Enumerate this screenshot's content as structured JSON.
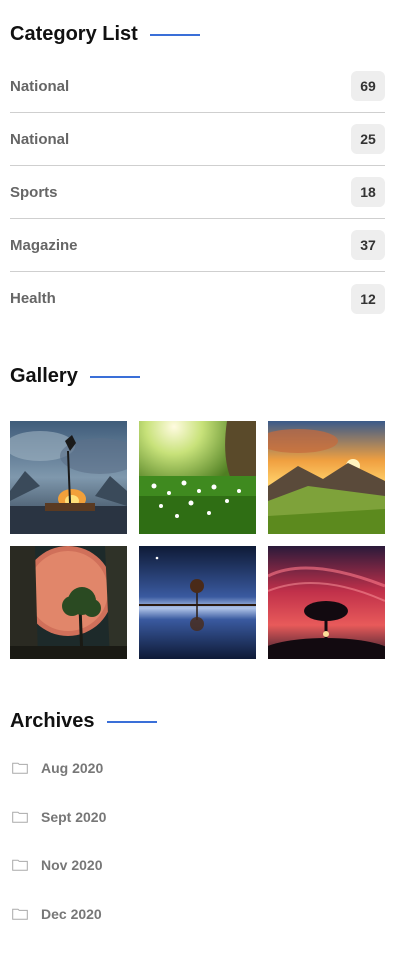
{
  "colors": {
    "accent": "#3a6fd8"
  },
  "category_list": {
    "title": "Category List",
    "items": [
      {
        "label": "National",
        "count": "69"
      },
      {
        "label": "National",
        "count": "25"
      },
      {
        "label": "Sports",
        "count": "18"
      },
      {
        "label": "Magazine",
        "count": "37"
      },
      {
        "label": "Health",
        "count": "12"
      }
    ]
  },
  "gallery": {
    "title": "Gallery",
    "images": [
      {
        "name": "raft-fire-night-image"
      },
      {
        "name": "sunlit-flower-meadow-image"
      },
      {
        "name": "mountain-sunset-image"
      },
      {
        "name": "red-moon-tree-image"
      },
      {
        "name": "tree-reflection-lake-image"
      },
      {
        "name": "tree-under-red-sky-image"
      }
    ]
  },
  "archives": {
    "title": "Archives",
    "items": [
      {
        "label": "Aug 2020",
        "icon": "folder-icon"
      },
      {
        "label": "Sept 2020",
        "icon": "folder-icon"
      },
      {
        "label": "Nov 2020",
        "icon": "folder-icon"
      },
      {
        "label": "Dec 2020",
        "icon": "folder-icon"
      }
    ]
  }
}
